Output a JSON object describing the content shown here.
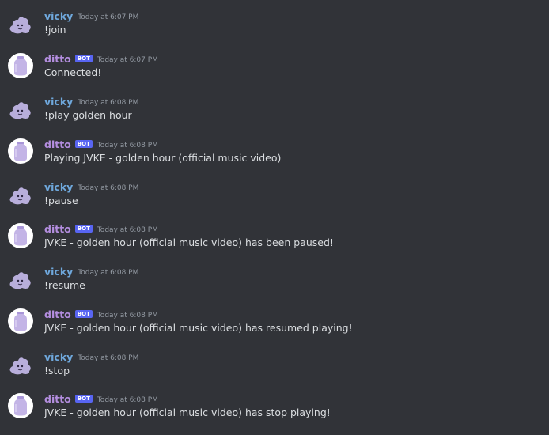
{
  "messages": [
    {
      "author": "vicky",
      "kind": "user",
      "time": "Today at 6:07 PM",
      "text": "!join"
    },
    {
      "author": "ditto",
      "kind": "bot",
      "badge": "BOT",
      "time": "Today at 6:07 PM",
      "text": "Connected!"
    },
    {
      "author": "vicky",
      "kind": "user",
      "time": "Today at 6:08 PM",
      "text": "!play golden hour"
    },
    {
      "author": "ditto",
      "kind": "bot",
      "badge": "BOT",
      "time": "Today at 6:08 PM",
      "text": "Playing JVKE - golden hour (official music video)"
    },
    {
      "author": "vicky",
      "kind": "user",
      "time": "Today at 6:08 PM",
      "text": "!pause"
    },
    {
      "author": "ditto",
      "kind": "bot",
      "badge": "BOT",
      "time": "Today at 6:08 PM",
      "text": "JVKE - golden hour (official music video) has been paused!"
    },
    {
      "author": "vicky",
      "kind": "user",
      "time": "Today at 6:08 PM",
      "text": "!resume"
    },
    {
      "author": "ditto",
      "kind": "bot",
      "badge": "BOT",
      "time": "Today at 6:08 PM",
      "text": "JVKE - golden hour (official music video) has resumed playing!"
    },
    {
      "author": "vicky",
      "kind": "user",
      "time": "Today at 6:08 PM",
      "text": "!stop"
    },
    {
      "author": "ditto",
      "kind": "bot",
      "badge": "BOT",
      "time": "Today at 6:08 PM",
      "text": "JVKE - golden hour (official music video) has stop playing!"
    }
  ],
  "colors": {
    "background": "#313338",
    "user_name": "#6fa8dc",
    "bot_name": "#b48ee0",
    "bot_badge": "#5865f2",
    "timestamp": "#949ba4",
    "message_text": "#dbdee1"
  },
  "icons": {
    "user_avatar": "ditto-blob-avatar-icon",
    "bot_avatar": "ditto-bottle-avatar-icon"
  }
}
